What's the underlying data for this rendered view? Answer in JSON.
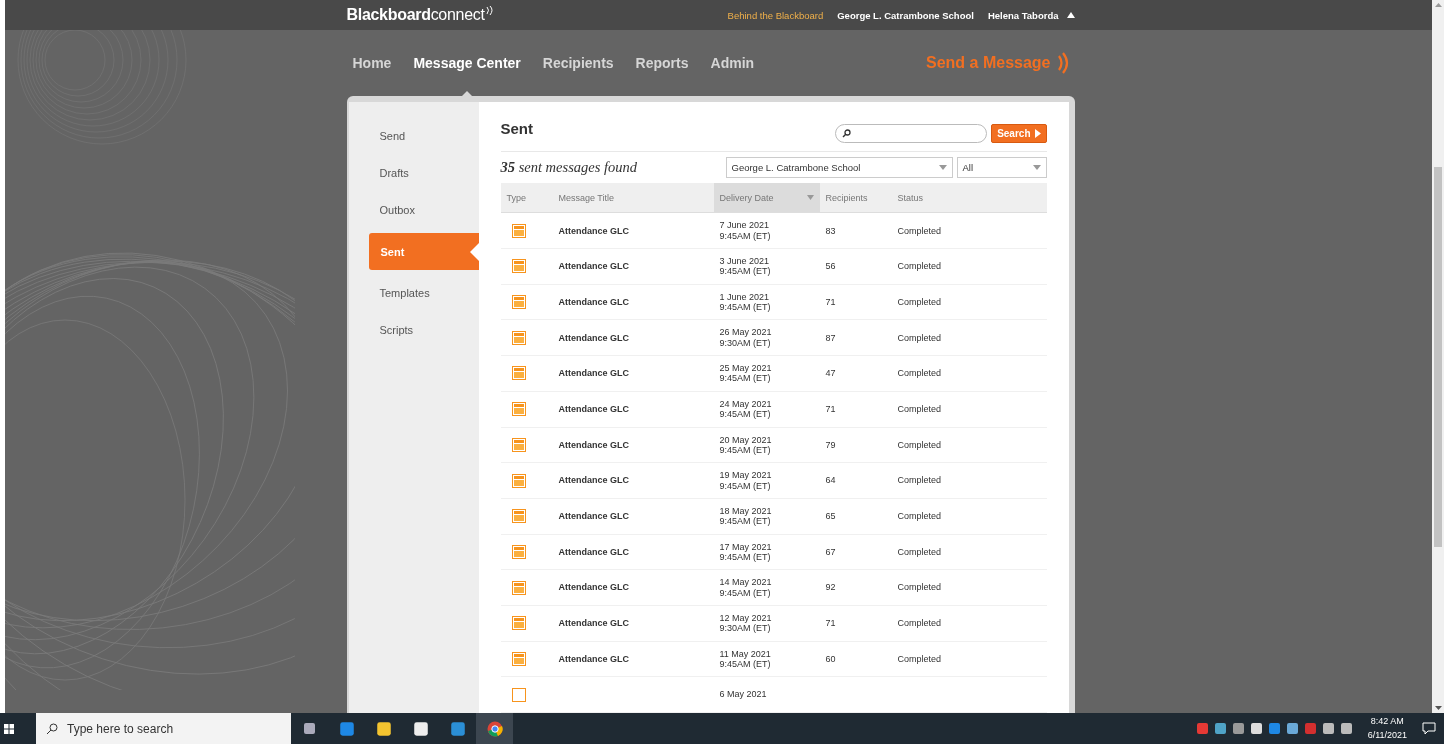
{
  "header": {
    "logo_bold": "Blackboard",
    "logo_light": "connect",
    "links": [
      {
        "label": "Behind the Blackboard",
        "kind": "accent"
      },
      {
        "label": "George L. Catrambone School",
        "kind": "plain"
      },
      {
        "label": "Helena Taborda",
        "kind": "menu"
      }
    ]
  },
  "nav": {
    "items": [
      {
        "label": "Home",
        "selected": false
      },
      {
        "label": "Message Center",
        "selected": true
      },
      {
        "label": "Recipients",
        "selected": false
      },
      {
        "label": "Reports",
        "selected": false
      },
      {
        "label": "Admin",
        "selected": false
      }
    ],
    "cta": "Send a Message"
  },
  "sidebar": {
    "items": [
      {
        "label": "Send",
        "selected": false
      },
      {
        "label": "Drafts",
        "selected": false
      },
      {
        "label": "Outbox",
        "selected": false
      },
      {
        "label": "Sent",
        "selected": true
      },
      {
        "label": "Templates",
        "selected": false
      },
      {
        "label": "Scripts",
        "selected": false
      }
    ]
  },
  "content": {
    "title": "Sent",
    "search_button": "Search",
    "count": "35",
    "count_text": "sent messages found",
    "school_filter": "George L. Catrambone School",
    "status_filter": "All",
    "table": {
      "columns": [
        {
          "label": "Type",
          "sorted": false
        },
        {
          "label": "Message Title",
          "sorted": false
        },
        {
          "label": "Delivery Date",
          "sorted": true
        },
        {
          "label": "Recipients",
          "sorted": false
        },
        {
          "label": "Status",
          "sorted": false
        }
      ],
      "rows": [
        {
          "title": "Attendance GLC",
          "date": "7 June 2021",
          "time": "9:45AM (ET)",
          "recipients": "83",
          "status": "Completed"
        },
        {
          "title": "Attendance GLC",
          "date": "3 June 2021",
          "time": "9:45AM (ET)",
          "recipients": "56",
          "status": "Completed"
        },
        {
          "title": "Attendance GLC",
          "date": "1 June 2021",
          "time": "9:45AM (ET)",
          "recipients": "71",
          "status": "Completed"
        },
        {
          "title": "Attendance GLC",
          "date": "26 May 2021",
          "time": "9:30AM (ET)",
          "recipients": "87",
          "status": "Completed"
        },
        {
          "title": "Attendance GLC",
          "date": "25 May 2021",
          "time": "9:45AM (ET)",
          "recipients": "47",
          "status": "Completed"
        },
        {
          "title": "Attendance GLC",
          "date": "24 May 2021",
          "time": "9:45AM (ET)",
          "recipients": "71",
          "status": "Completed"
        },
        {
          "title": "Attendance GLC",
          "date": "20 May 2021",
          "time": "9:45AM (ET)",
          "recipients": "79",
          "status": "Completed"
        },
        {
          "title": "Attendance GLC",
          "date": "19 May 2021",
          "time": "9:45AM (ET)",
          "recipients": "64",
          "status": "Completed"
        },
        {
          "title": "Attendance GLC",
          "date": "18 May 2021",
          "time": "9:45AM (ET)",
          "recipients": "65",
          "status": "Completed"
        },
        {
          "title": "Attendance GLC",
          "date": "17 May 2021",
          "time": "9:45AM (ET)",
          "recipients": "67",
          "status": "Completed"
        },
        {
          "title": "Attendance GLC",
          "date": "14 May 2021",
          "time": "9:45AM (ET)",
          "recipients": "92",
          "status": "Completed"
        },
        {
          "title": "Attendance GLC",
          "date": "12 May 2021",
          "time": "9:30AM (ET)",
          "recipients": "71",
          "status": "Completed"
        },
        {
          "title": "Attendance GLC",
          "date": "11 May 2021",
          "time": "9:45AM (ET)",
          "recipients": "60",
          "status": "Completed"
        },
        {
          "date": "6 May 2021"
        }
      ]
    }
  },
  "taskbar": {
    "search_placeholder": "Type here to search",
    "time": "8:42 AM",
    "date": "6/11/2021"
  }
}
